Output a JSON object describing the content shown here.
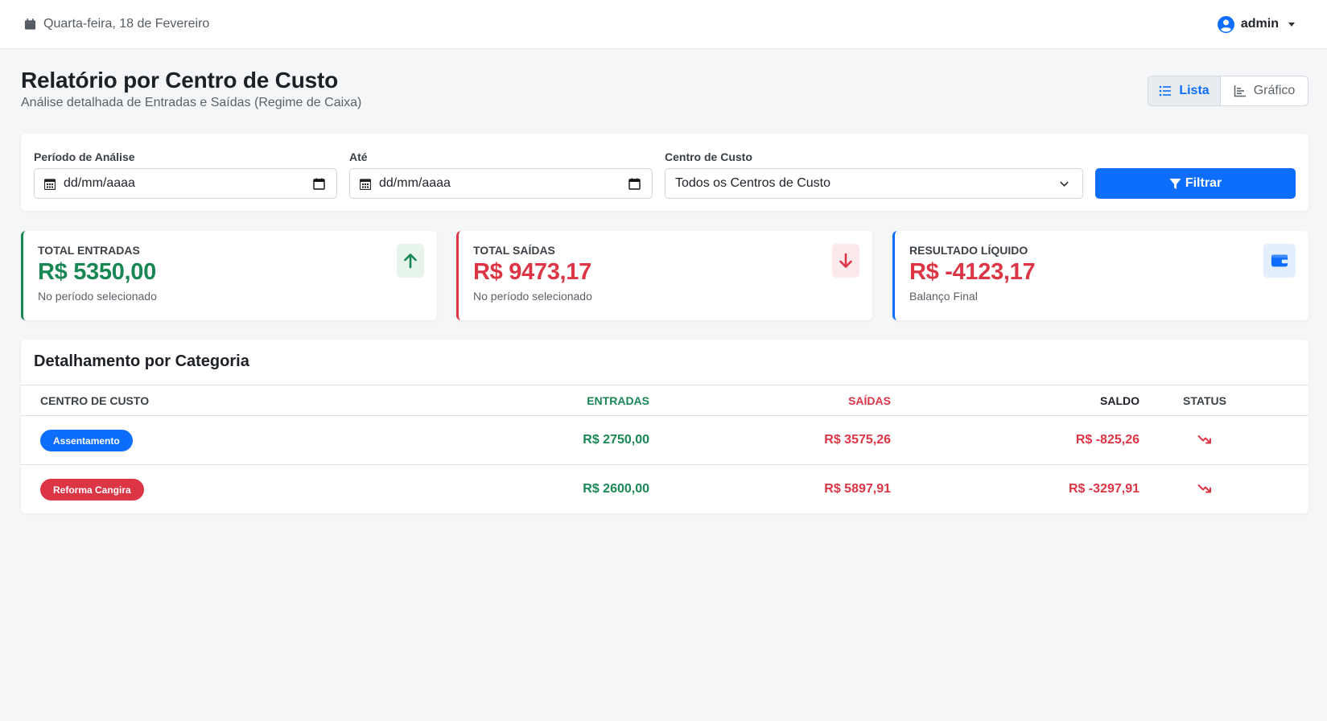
{
  "topbar": {
    "date": "Quarta-feira, 18 de Fevereiro",
    "user": "admin"
  },
  "header": {
    "title": "Relatório por Centro de Custo",
    "subtitle": "Análise detalhada de Entradas e Saídas (Regime de Caixa)"
  },
  "view_toggle": {
    "list_label": "Lista",
    "chart_label": "Gráfico",
    "active": "Lista"
  },
  "filters": {
    "period_label": "Período de Análise",
    "period_value": "dd/mm/aaaa",
    "until_label": "Até",
    "until_value": "dd/mm/aaaa",
    "cost_center_label": "Centro de Custo",
    "cost_center_value": "Todos os Centros de Custo",
    "filter_button": "Filtrar"
  },
  "stats": {
    "entradas": {
      "label": "Total Entradas",
      "value": "R$ 5350,00",
      "note": "No período selecionado"
    },
    "saidas": {
      "label": "Total Saídas",
      "value": "R$ 9473,17",
      "note": "No período selecionado"
    },
    "resultado": {
      "label": "Resultado Líquido",
      "value": "R$ -4123,17",
      "note": "Balanço Final"
    }
  },
  "table": {
    "title": "Detalhamento por Categoria",
    "headers": {
      "cost_center": "CENTRO DE CUSTO",
      "entradas": "ENTRADAS",
      "saidas": "SAÍDAS",
      "saldo": "SALDO",
      "status": "STATUS"
    },
    "rows": [
      {
        "cost_center": "Assentamento",
        "badge_color": "#0d6efd",
        "entradas": "R$ 2750,00",
        "saidas": "R$ 3575,26",
        "saldo": "R$ -825,26",
        "status_icon": "trend-down-icon"
      },
      {
        "cost_center": "Reforma Cangira",
        "badge_color": "#dc3545",
        "entradas": "R$ 2600,00",
        "saidas": "R$ 5897,91",
        "saldo": "R$ -3297,91",
        "status_icon": "trend-down-icon"
      }
    ]
  },
  "colors": {
    "primary": "#0d6efd",
    "success": "#198754",
    "danger": "#dc3545",
    "background": "#f5f6f8"
  }
}
